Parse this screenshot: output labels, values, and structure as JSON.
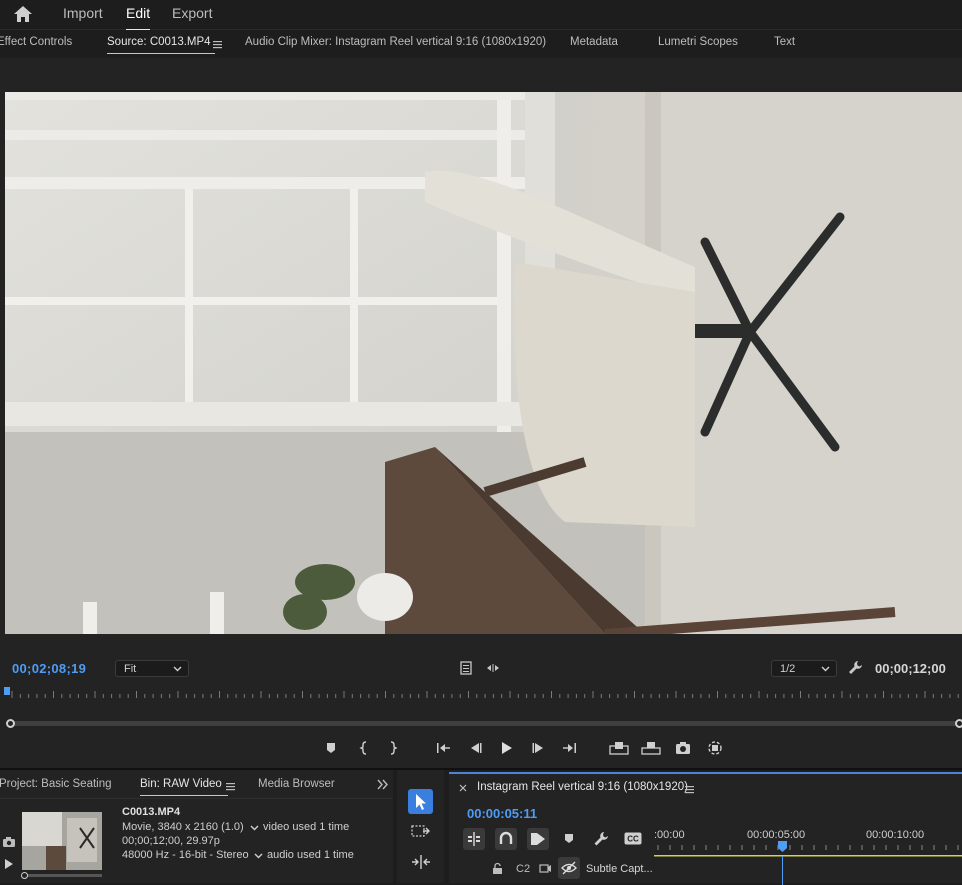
{
  "topbar": {
    "nav": [
      "Import",
      "Edit",
      "Export"
    ],
    "active": "Edit"
  },
  "tabs": {
    "effect_controls": "Effect Controls",
    "source": "Source: C0013.MP4",
    "audio_mixer": "Audio Clip Mixer: Instagram Reel vertical 9:16 (1080x1920)",
    "metadata": "Metadata",
    "lumetri": "Lumetri Scopes",
    "text": "Text"
  },
  "source_monitor": {
    "current_timecode": "00;02;08;19",
    "duration_timecode": "00;00;12;00",
    "zoom": "Fit",
    "resolution": "1/2",
    "playhead_fraction": 0.0
  },
  "project_panel": {
    "tabs": [
      "Project: Basic Seating",
      "Bin: RAW Video",
      "Media Browser"
    ],
    "clip": {
      "name": "C0013.MP4",
      "line1": "Movie, 3840 x 2160 (1.0)",
      "video_usage": "video used 1 time",
      "line2": "00;00;12;00, 29.97p",
      "line3": "48000 Hz - 16-bit - Stereo",
      "audio_usage": "audio used 1 time"
    }
  },
  "timeline": {
    "sequence_title": "Instagram Reel vertical 9:16 (1080x1920)",
    "timecode": "00:00:05:11",
    "ruler_labels": [
      ":00:00",
      "00:00:05:00",
      "00:00:10:00"
    ],
    "track_label": "C2",
    "track_name": "Subtle Capt..."
  },
  "colors": {
    "accent_blue": "#4f9cf5",
    "panel_bg": "#232323",
    "app_bg": "#1d1d1d",
    "work_area_yellow": "#d8d24a"
  },
  "icons": [
    "home-icon",
    "panel-menu-icon",
    "safe-margins-icon",
    "export-frame-icon",
    "wrench-icon",
    "marker-icon",
    "in-point-icon",
    "out-point-icon",
    "go-to-in-icon",
    "step-back-icon",
    "play-icon",
    "step-forward-icon",
    "go-to-out-icon",
    "insert-icon",
    "overwrite-icon",
    "camera-icon",
    "button-editor-icon",
    "selection-tool-icon",
    "track-select-icon",
    "ripple-edit-icon",
    "lock-icon",
    "toggle-output-icon",
    "eye-icon",
    "snap-icon",
    "linked-selection-icon",
    "captions-icon"
  ]
}
